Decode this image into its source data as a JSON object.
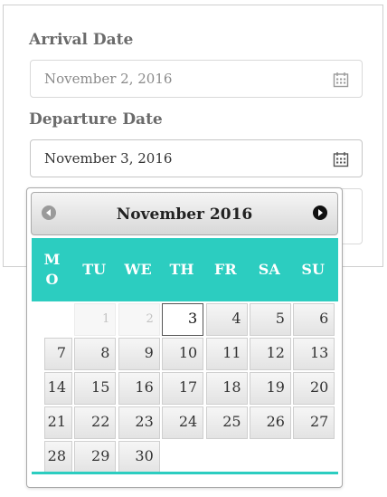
{
  "form": {
    "arrival_label": "Arrival Date",
    "arrival_value": "November 2, 2016",
    "departure_label": "Departure Date",
    "departure_value": "November 3, 2016"
  },
  "datepicker": {
    "month": "November",
    "year": "2016",
    "weekday_headers": [
      "MO",
      "TU",
      "WE",
      "TH",
      "FR",
      "SA",
      "SU"
    ],
    "selected_day": "3",
    "weeks": [
      [
        "",
        "1",
        "2",
        "3",
        "4",
        "5",
        "6"
      ],
      [
        "7",
        "8",
        "9",
        "10",
        "11",
        "12",
        "13"
      ],
      [
        "14",
        "15",
        "16",
        "17",
        "18",
        "19",
        "20"
      ],
      [
        "21",
        "22",
        "23",
        "24",
        "25",
        "26",
        "27"
      ],
      [
        "28",
        "29",
        "30",
        "",
        "",
        "",
        ""
      ]
    ]
  },
  "colors": {
    "accent": "#2ccdc0",
    "label": "#6b6b6b",
    "placeholder_text": "#8a8a8a",
    "value_text": "#333333"
  }
}
